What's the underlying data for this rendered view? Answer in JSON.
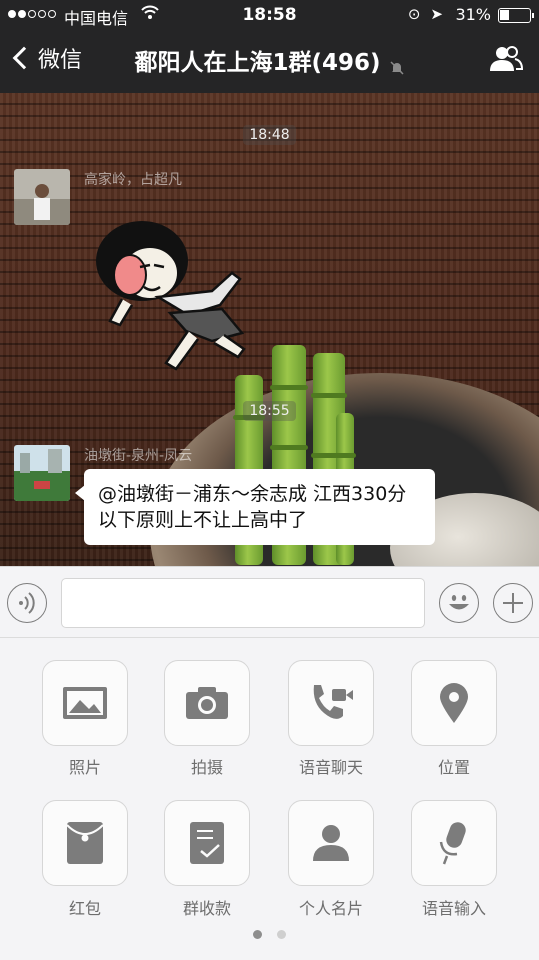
{
  "status_bar": {
    "carrier": "中国电信",
    "time": "18:58",
    "battery": "31%",
    "battery_level": 0.31
  },
  "nav": {
    "back_label": "微信",
    "title": "鄱阳人在上海1群(496)"
  },
  "chat": {
    "messages": [
      {
        "time": "18:48",
        "sender": "高家岭，占超凡",
        "type": "sticker"
      },
      {
        "time": "18:55",
        "sender": "油墩街-泉州-凤云",
        "type": "text",
        "text": "@油墩街－浦东～余志成 江西330分以下原则上不让上高中了"
      }
    ]
  },
  "panel": {
    "items": [
      {
        "label": "照片",
        "icon": "photo-icon"
      },
      {
        "label": "拍摄",
        "icon": "camera-icon"
      },
      {
        "label": "语音聊天",
        "icon": "video-call-icon"
      },
      {
        "label": "位置",
        "icon": "location-icon"
      },
      {
        "label": "红包",
        "icon": "red-packet-icon"
      },
      {
        "label": "群收款",
        "icon": "group-payment-icon"
      },
      {
        "label": "个人名片",
        "icon": "contact-card-icon"
      },
      {
        "label": "语音输入",
        "icon": "microphone-icon"
      }
    ],
    "page_dots": {
      "count": 2,
      "active": 0
    }
  },
  "colors": {
    "nav_bg": "#252526",
    "panel_bg": "#f4f4f6",
    "icon_gray": "#7c7c7c"
  }
}
